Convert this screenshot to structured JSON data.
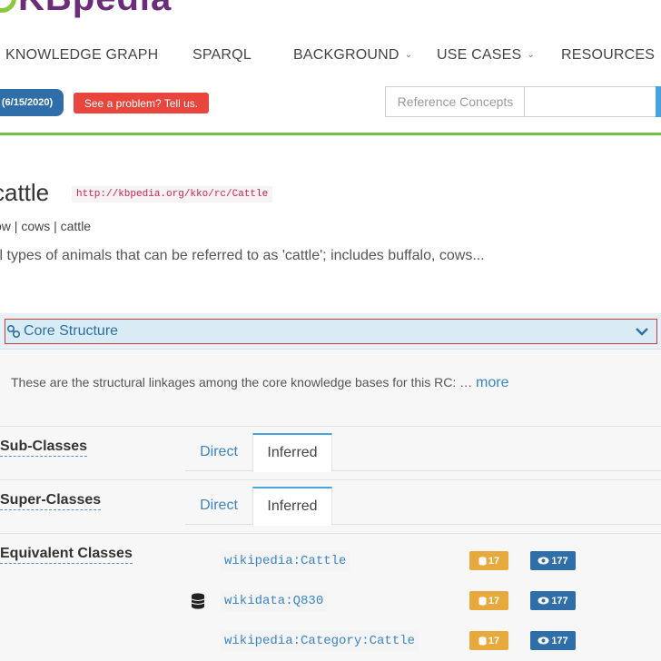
{
  "brand": {
    "logo_text": "KBpedia",
    "accent": "#7ac142",
    "logo_color": "#6b2c7a"
  },
  "nav": {
    "items": [
      {
        "label": "KNOWLEDGE GRAPH",
        "has_caret": false
      },
      {
        "label": "SPARQL",
        "has_caret": false
      },
      {
        "label": "BACKGROUND",
        "has_caret": true
      },
      {
        "label": "USE CASES",
        "has_caret": true
      },
      {
        "label": "RESOURCES",
        "has_caret": true
      }
    ],
    "caret": "⌄"
  },
  "toolbar": {
    "version_badge": "(6/15/2020)",
    "report_button": "See a problem? Tell us.",
    "search_scope": "Reference Concepts",
    "search_value": ""
  },
  "concept": {
    "title": "cattle",
    "uri": "http://kbpedia.org/kko/rc/Cattle",
    "alt_labels": "ow | cows | cattle",
    "definition": "ll types of animals that can be referred to as 'cattle'; includes buffalo, cows..."
  },
  "core_structure": {
    "title": "Core Structure",
    "intro": "These are the structural linkages among the core knowledge bases for this RC: …",
    "more_link": "more",
    "sub_classes": {
      "label": "Sub-Classes",
      "tabs": [
        "Direct",
        "Inferred"
      ],
      "active": "Inferred"
    },
    "super_classes": {
      "label": "Super-Classes",
      "tabs": [
        "Direct",
        "Inferred"
      ],
      "active": "Inferred"
    },
    "equivalent_classes": {
      "label": "Equivalent Classes",
      "items": [
        {
          "id": "wikipedia:Cattle",
          "count": "17",
          "views": "177",
          "show_db_icon": false
        },
        {
          "id": "wikidata:Q830",
          "count": "17",
          "views": "177",
          "show_db_icon": true
        },
        {
          "id": "wikipedia:Category:Cattle",
          "count": "17",
          "views": "177",
          "show_db_icon": false
        }
      ]
    }
  }
}
